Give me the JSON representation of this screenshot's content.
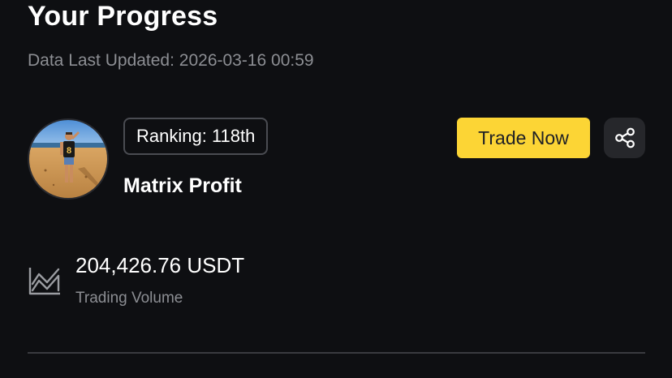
{
  "header": {
    "title": "Your Progress",
    "last_updated": "Data Last Updated: 2026-03-16 00:59"
  },
  "profile": {
    "avatar_icon": "user-avatar-photo",
    "ranking": "Ranking: 118th",
    "name": "Matrix Profit"
  },
  "actions": {
    "trade_label": "Trade Now",
    "share_icon": "share-icon"
  },
  "stats": {
    "icon": "trading-chart-icon",
    "volume_value": "204,426.76 USDT",
    "volume_label": "Trading Volume"
  },
  "colors": {
    "background": "#0e0f12",
    "accent": "#fcd535",
    "muted_text": "#8c8e93"
  }
}
